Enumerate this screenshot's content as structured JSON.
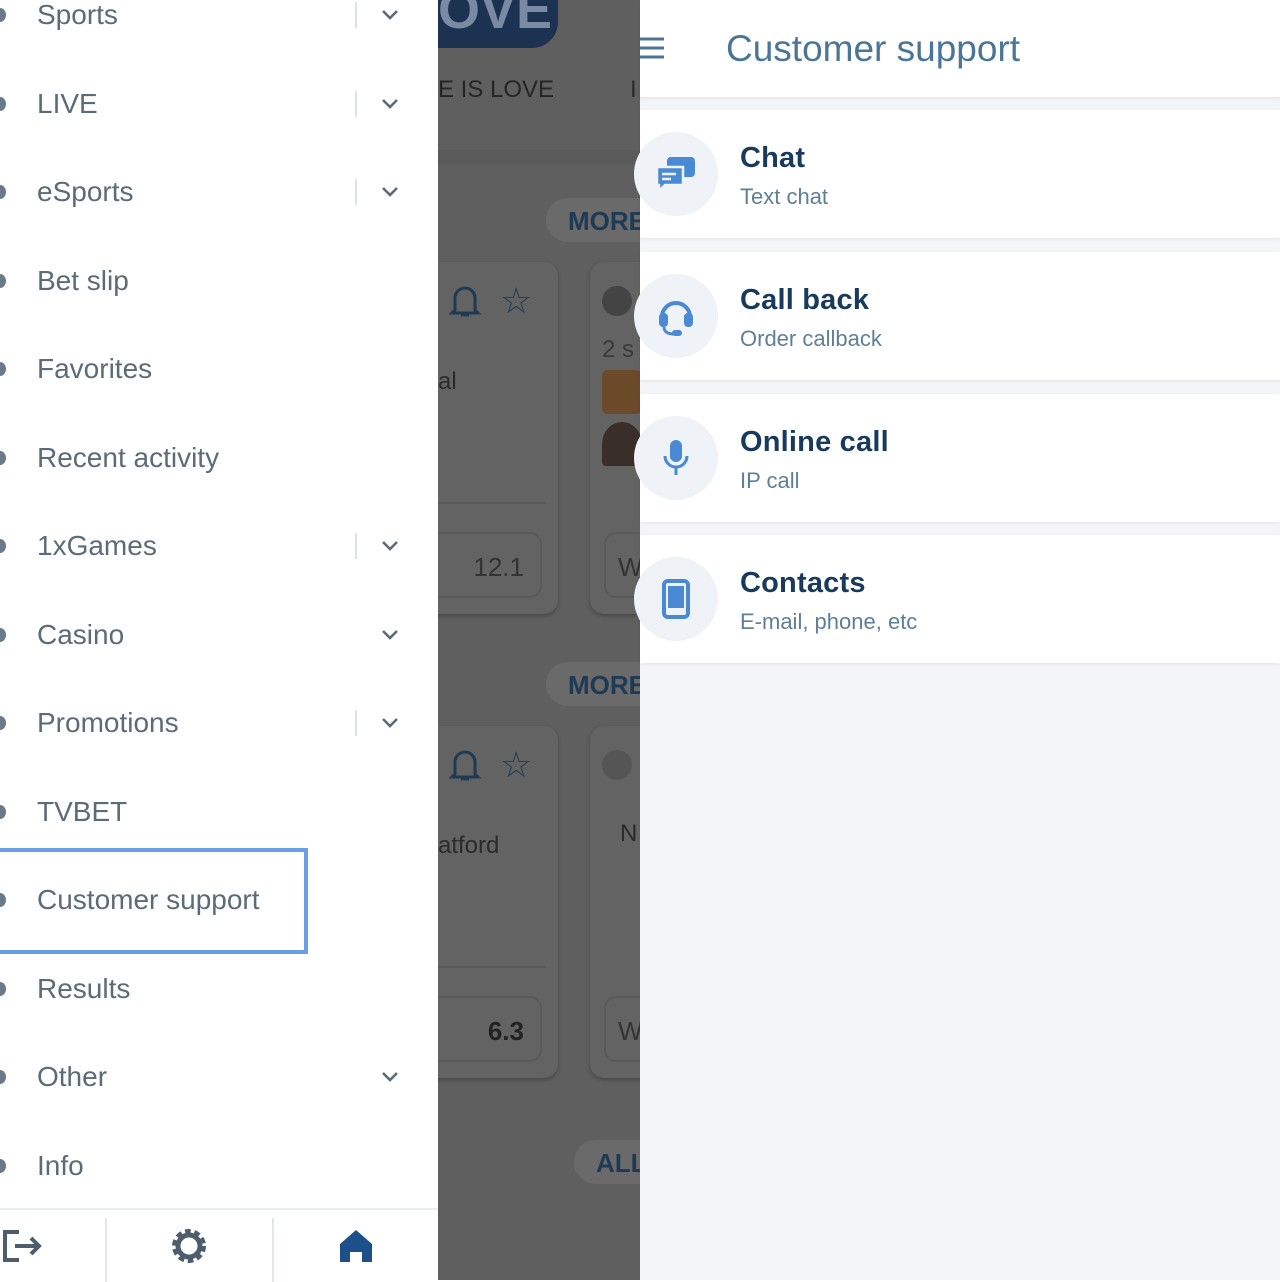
{
  "menu": {
    "items": [
      {
        "label": "Sports",
        "chevron": true,
        "divider": true
      },
      {
        "label": "LIVE",
        "chevron": true,
        "divider": true
      },
      {
        "label": "eSports",
        "chevron": true,
        "divider": true
      },
      {
        "label": "Bet slip",
        "chevron": false,
        "divider": false
      },
      {
        "label": "Favorites",
        "chevron": false,
        "divider": false
      },
      {
        "label": "Recent activity",
        "chevron": false,
        "divider": false
      },
      {
        "label": "1xGames",
        "chevron": true,
        "divider": true
      },
      {
        "label": "Casino",
        "chevron": true,
        "divider": false
      },
      {
        "label": "Promotions",
        "chevron": true,
        "divider": true
      },
      {
        "label": "TVBET",
        "chevron": false,
        "divider": false
      },
      {
        "label": "Customer support",
        "chevron": false,
        "divider": false,
        "highlighted": true
      },
      {
        "label": "Results",
        "chevron": false,
        "divider": false
      },
      {
        "label": "Other",
        "chevron": true,
        "divider": false
      },
      {
        "label": "Info",
        "chevron": false,
        "divider": false
      }
    ],
    "bottom": [
      "logout-icon",
      "settings-icon",
      "home-icon"
    ],
    "highlight_color": "#6a9fe8"
  },
  "background": {
    "banner_text": "E IS LOVE",
    "banner_text2": "I",
    "more1": "MORE",
    "more2": "MORE",
    "all": "ALL",
    "card1": {
      "text": "al",
      "odd": "12.1"
    },
    "card2": {
      "text": "2 s",
      "odd": "W"
    },
    "card3": {
      "text": "atford",
      "odd": "6.3"
    },
    "card4": {
      "text": "N",
      "odd": "W"
    }
  },
  "support": {
    "title": "Customer support",
    "options": [
      {
        "title": "Chat",
        "subtitle": "Text chat",
        "icon": "chat-icon"
      },
      {
        "title": "Call back",
        "subtitle": "Order callback",
        "icon": "headset-icon"
      },
      {
        "title": "Online call",
        "subtitle": "IP call",
        "icon": "microphone-icon"
      },
      {
        "title": "Contacts",
        "subtitle": "E-mail, phone, etc",
        "icon": "phone-icon"
      }
    ],
    "accent": "#4a8ad4"
  }
}
